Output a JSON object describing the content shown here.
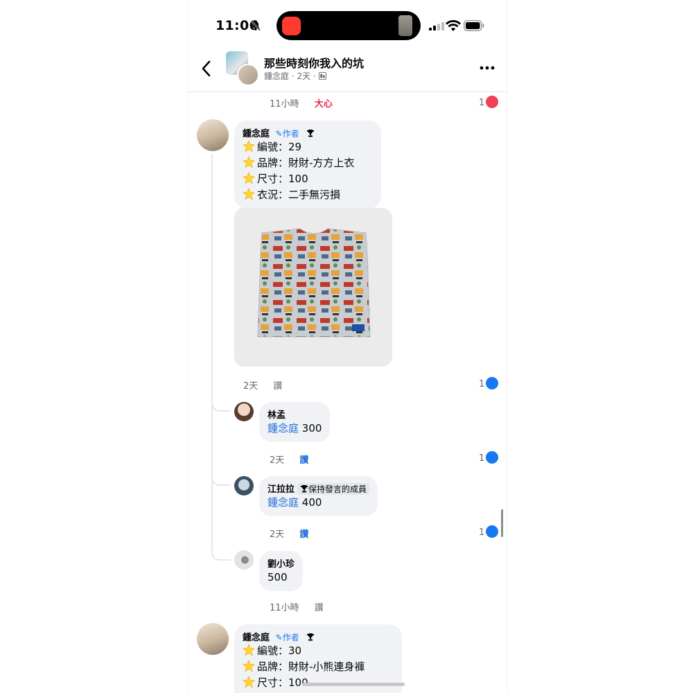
{
  "status_bar": {
    "time": "11:06",
    "bell_icon": "bell-slash-icon",
    "signal_icon": "signal-icon",
    "wifi_icon": "wifi-icon",
    "battery_icon": "battery-icon"
  },
  "header": {
    "back_icon": "chevron-left-icon",
    "title": "那些時刻你我入的坑",
    "author": "鍾念庭",
    "time": "2天",
    "audience_icon": "group-icon",
    "more_icon": "more-horizontal-icon"
  },
  "top_meta": {
    "time": "11小時",
    "reaction_label": "大心",
    "count": "1"
  },
  "comments": [
    {
      "author": "鍾念庭",
      "badge": "作者",
      "lines": [
        "編號：29",
        "品牌：財財-方方上衣",
        "尺寸：100",
        "衣況：二手無污損"
      ],
      "time": "2天",
      "action": "讚",
      "likes": "1"
    },
    {
      "author": "鍾念庭",
      "badge": "作者",
      "lines": [
        "編號：30",
        "品牌：財財-小熊連身褲",
        "尺寸：100"
      ]
    }
  ],
  "replies": [
    {
      "author": "林孟",
      "mention": "鍾念庭",
      "text": "300",
      "time": "2天",
      "action": "讚",
      "likes": "1"
    },
    {
      "author": "江拉拉",
      "member_tag": "保持發言的成員",
      "mention": "鍾念庭",
      "text": "400",
      "time": "2天",
      "action": "讚",
      "likes": "1"
    },
    {
      "author": "劉小珍",
      "text": "500",
      "time": "11小時",
      "action": "讚"
    }
  ],
  "colors": {
    "link": "#216fdb",
    "love": "#f02849",
    "like": "#1877f2",
    "bubble": "#f0f2f5"
  }
}
